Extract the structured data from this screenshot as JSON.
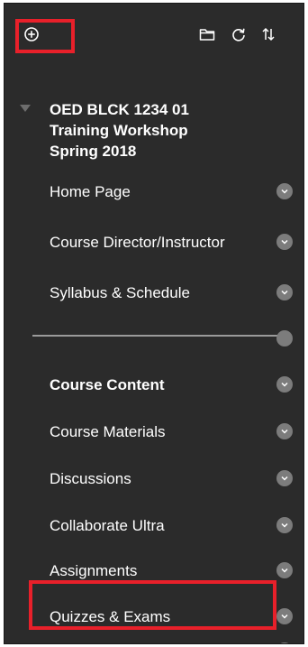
{
  "toolbar": {
    "add_icon": "plus-circle-icon",
    "folder_icon": "folder-icon",
    "refresh_icon": "refresh-icon",
    "sort_icon": "sort-icon"
  },
  "course": {
    "title_line1": "OED BLCK 1234 01",
    "title_line2": "Training Workshop",
    "title_line3": "Spring 2018"
  },
  "menu": {
    "items": [
      {
        "label": "Home Page"
      },
      {
        "label": "Course Director/Instructor"
      },
      {
        "label": "Syllabus & Schedule"
      },
      {
        "label": "Course Content"
      },
      {
        "label": "Course Materials"
      },
      {
        "label": "Discussions"
      },
      {
        "label": "Collaborate Ultra"
      },
      {
        "label": "Assignments"
      },
      {
        "label": "Quizzes & Exams"
      }
    ]
  },
  "colors": {
    "panel_bg": "#2b2b2b",
    "highlight": "#e8202a",
    "chevron": "#7c7c7c",
    "text": "#ffffff"
  }
}
